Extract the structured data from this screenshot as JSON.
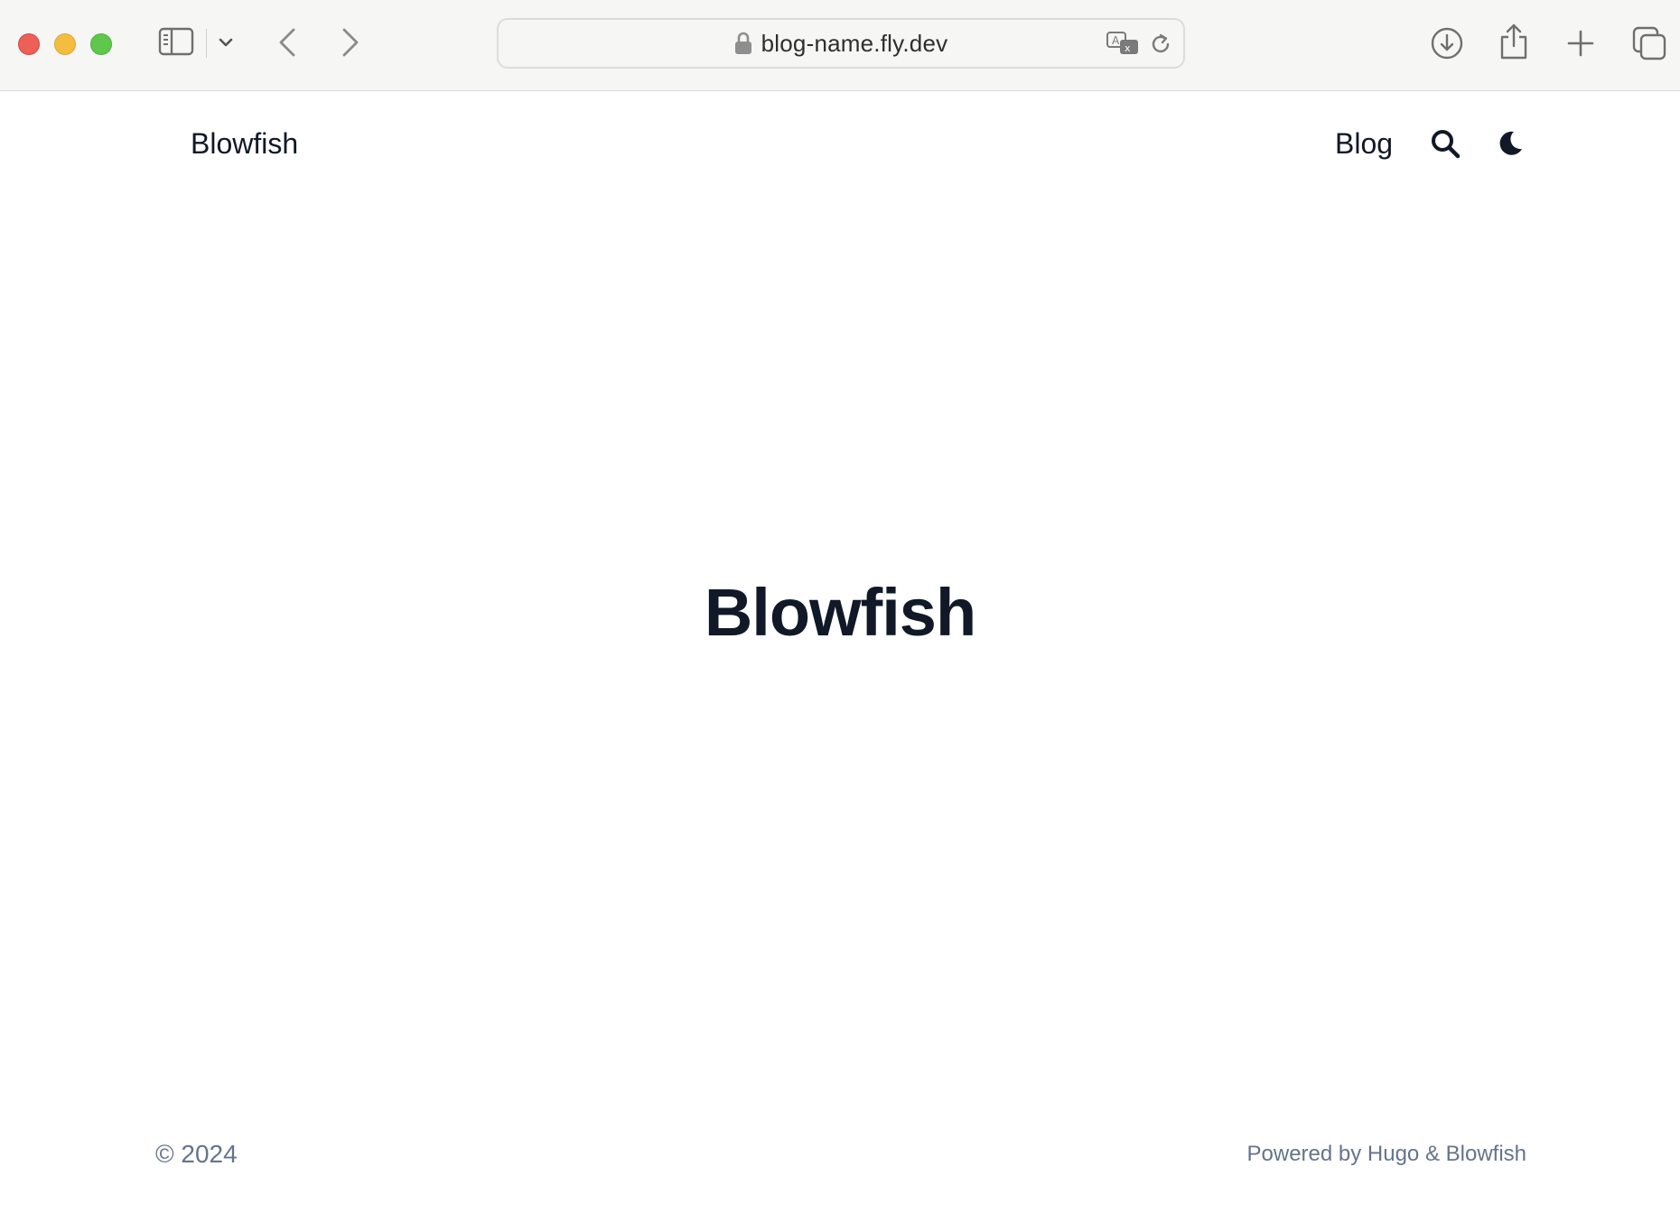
{
  "browser": {
    "url": "blog-name.fly.dev",
    "icons": {
      "sidebar": "sidebar-icon",
      "sidebar_menu": "chevron-down-icon",
      "back": "chevron-left-icon",
      "forward": "chevron-right-icon",
      "lock": "lock-icon",
      "translate": "translate-icon",
      "reload": "reload-icon",
      "download": "download-icon",
      "share": "share-icon",
      "new_tab": "plus-icon",
      "tab_overview": "tabs-icon"
    }
  },
  "header": {
    "site_title": "Blowfish",
    "nav": [
      {
        "label": "Blog"
      }
    ],
    "search_icon": "search-icon",
    "theme_icon": "moon-icon"
  },
  "hero": {
    "title": "Blowfish"
  },
  "footer": {
    "copyright": "© 2024",
    "powered_by": "Powered by Hugo & Blowfish"
  },
  "colors": {
    "text_primary": "#111827",
    "text_muted": "#64748b",
    "chrome_bg": "#f6f6f5",
    "close": "#ee5f57",
    "minimize": "#f5bd3f",
    "maximize": "#5fc84c"
  }
}
